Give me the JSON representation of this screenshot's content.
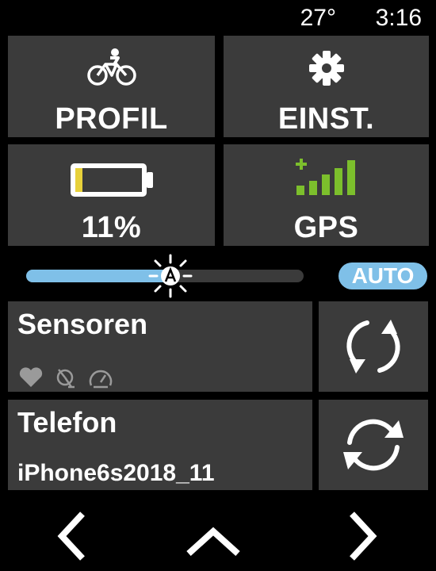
{
  "status": {
    "temperature": "27°",
    "time": "3:16"
  },
  "tiles": {
    "profile": {
      "label": "PROFIL",
      "icon": "bicycle-icon"
    },
    "settings": {
      "label": "EINST.",
      "icon": "gear-icon"
    },
    "battery": {
      "label": "11%",
      "icon": "battery-icon",
      "level": 0.11
    },
    "gps": {
      "label": "GPS",
      "icon": "signal-bars-icon"
    }
  },
  "brightness": {
    "level": 0.52,
    "auto_label": "AUTO"
  },
  "sensors": {
    "title": "Sensoren",
    "icons": [
      "heart-icon",
      "cadence-icon",
      "speedometer-icon"
    ]
  },
  "phone": {
    "title": "Telefon",
    "device": "iPhone6s2018_11"
  },
  "colors": {
    "tile": "#3b3b3b",
    "accent_blue": "#7fc0e8",
    "battery_yellow": "#e8d13a",
    "gps_green": "#7cbf2c",
    "muted": "#9a9a9a"
  },
  "nav": [
    "chevron-left-icon",
    "chevron-up-icon",
    "chevron-right-icon"
  ]
}
